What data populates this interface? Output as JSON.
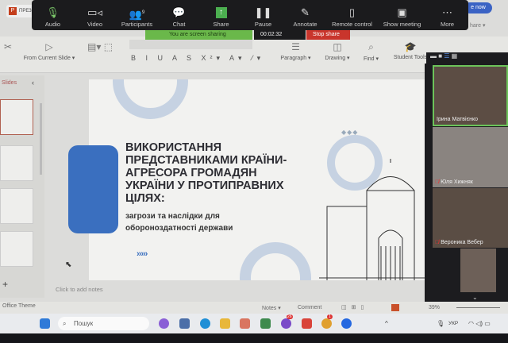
{
  "app_tab": "ПРЕЗ",
  "present_button": "e now",
  "zoom_toolbar": [
    {
      "label": "Audio",
      "icon": "microphone-icon"
    },
    {
      "label": "Video",
      "icon": "video-camera-icon"
    },
    {
      "label": "Participants",
      "icon": "participants-icon",
      "count": "9"
    },
    {
      "label": "Chat",
      "icon": "chat-icon"
    },
    {
      "label": "Share",
      "icon": "share-icon"
    },
    {
      "label": "Pause",
      "icon": "pause-icon"
    },
    {
      "label": "Annotate",
      "icon": "pencil-icon"
    },
    {
      "label": "Remote control",
      "icon": "mouse-icon"
    },
    {
      "label": "Show meeting",
      "icon": "monitor-icon"
    },
    {
      "label": "More",
      "icon": "more-icon"
    }
  ],
  "sharing": {
    "status": "You are screen sharing",
    "timer": "00:02:32",
    "stop": "Stop share"
  },
  "ribbon": {
    "from_current_slide": "From Current Slide ▾",
    "paragraph": "Paragraph ▾",
    "drawing": "Drawing ▾",
    "find": "Find ▾",
    "student_tools": "Student Tools",
    "share": "hare ▾"
  },
  "slides_panel": {
    "title": "Slides"
  },
  "slide": {
    "title": "ВИКОРИСТАННЯ ПРЕДСТАВНИКАМИ КРАЇНИ-АГРЕСОРА ГРОМАДЯН УКРАЇНИ У ПРОТИПРАВНИХ ЦІЛЯХ:",
    "subtitle": "загрози та наслідки для обороноздатності держави",
    "chevrons": "›››››"
  },
  "notes_placeholder": "Click to add notes",
  "participants": [
    {
      "name": "Ірина Матвієнко",
      "muted": false
    },
    {
      "name": "Юля Хижняк",
      "muted": true
    },
    {
      "name": "Вероника Вебер",
      "muted": true
    },
    {
      "name": "",
      "muted": false
    }
  ],
  "status_bar": {
    "theme": "Office Theme",
    "notes": "Notes ▾",
    "comment": "Comment",
    "zoom": "39%"
  },
  "taskbar": {
    "search_placeholder": "Пошук",
    "language": "УКР",
    "badges": {
      "viber": "26",
      "chrome": "1"
    }
  }
}
